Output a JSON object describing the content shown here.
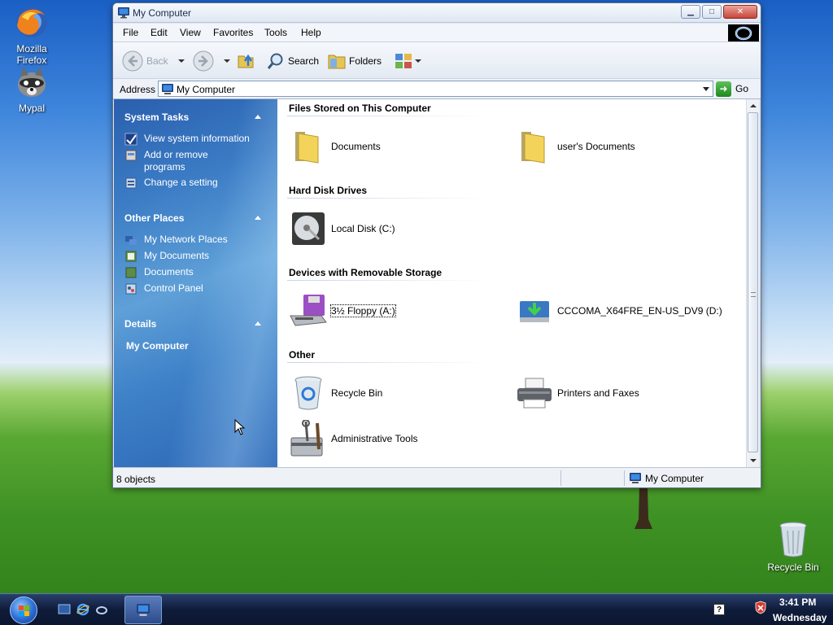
{
  "desktop": {
    "firefox_label": "Mozilla Firefox",
    "mypal_label": "Mypal",
    "recycle_label": "Recycle Bin"
  },
  "window": {
    "title": "My Computer",
    "menu": [
      "File",
      "Edit",
      "View",
      "Favorites",
      "Tools",
      "Help"
    ],
    "toolbar": {
      "back": "Back",
      "search": "Search",
      "folders": "Folders"
    },
    "address": {
      "label": "Address",
      "value": "My Computer",
      "go": "Go"
    },
    "taskpane": {
      "system_tasks": {
        "title": "System Tasks",
        "items": [
          "View system information",
          "Add or remove programs",
          "Change a setting"
        ]
      },
      "other_places": {
        "title": "Other Places",
        "items": [
          "My Network Places",
          "My Documents",
          "Documents",
          "Control Panel"
        ]
      },
      "details": {
        "title": "Details",
        "name": "My Computer"
      }
    },
    "content": {
      "groups": [
        {
          "title": "Files Stored on This Computer",
          "items": [
            "Documents",
            "user's Documents"
          ]
        },
        {
          "title": "Hard Disk Drives",
          "items": [
            "Local Disk (C:)"
          ]
        },
        {
          "title": "Devices with Removable Storage",
          "items": [
            "3½ Floppy (A:)",
            "CCCOMA_X64FRE_EN-US_DV9 (D:)"
          ]
        },
        {
          "title": "Other",
          "items": [
            "Recycle Bin",
            "Printers and Faxes",
            "Administrative Tools"
          ]
        }
      ]
    },
    "status": {
      "count": "8 objects",
      "location": "My Computer"
    }
  },
  "taskbar": {
    "time": "3:41 PM",
    "day": "Wednesday"
  },
  "colors": {
    "taskpane_blue": "#2a5fae",
    "title_text": "#1b2e4d",
    "close_red": "#c8453a"
  }
}
